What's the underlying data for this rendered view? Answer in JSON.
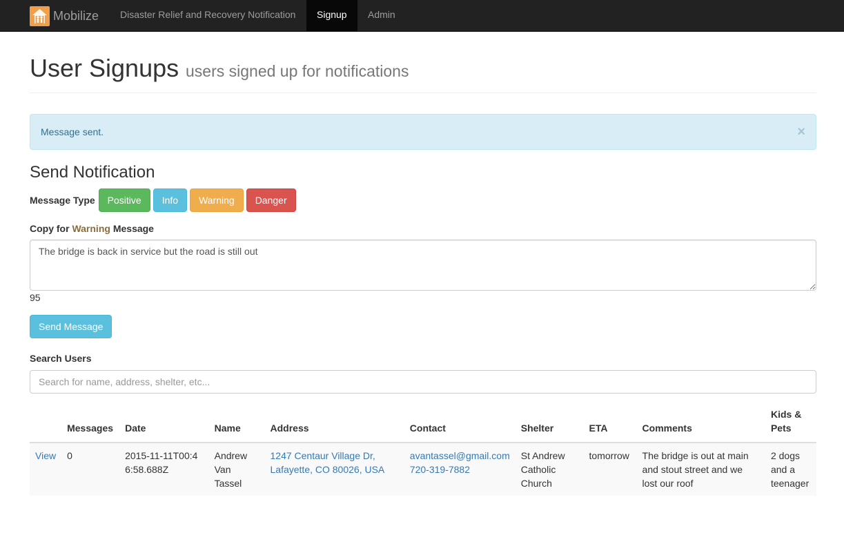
{
  "navbar": {
    "brand": "Mobilize",
    "items": [
      {
        "label": "Disaster Relief and Recovery Notification"
      },
      {
        "label": "Signup"
      },
      {
        "label": "Admin"
      }
    ]
  },
  "header": {
    "title": "User Signups",
    "subtitle": "users signed up for notifications"
  },
  "alert": {
    "message": "Message sent.",
    "close": "×"
  },
  "notification": {
    "title": "Send Notification",
    "message_type_label": "Message Type",
    "types": [
      "Positive",
      "Info",
      "Warning",
      "Danger"
    ],
    "copy_label_prefix": "Copy for",
    "copy_label_type": "Warning",
    "copy_label_suffix": "Message",
    "message_text": "The bridge is back in service but the road is still out",
    "char_count": "95",
    "send_label": "Send Message"
  },
  "search": {
    "label": "Search Users",
    "placeholder": "Search for name, address, shelter, etc..."
  },
  "table": {
    "headers": [
      "",
      "Messages",
      "Date",
      "Name",
      "Address",
      "Contact",
      "Shelter",
      "ETA",
      "Comments",
      "Kids & Pets"
    ],
    "rows": [
      {
        "view": "View",
        "messages": "0",
        "date": "2015-11-11T00:46:58.688Z",
        "name": "Andrew Van Tassel",
        "address": "1247 Centaur Village Dr, Lafayette, CO 80026, USA",
        "email": "avantassel@gmail.com",
        "phone": "720-319-7882",
        "shelter": "St Andrew Catholic Church",
        "eta": "tomorrow",
        "comments": "The bridge is out at main and stout street and we lost our roof",
        "kids_pets": "2 dogs and a teenager"
      }
    ]
  },
  "colors": {
    "navbar_bg": "#222222",
    "positive": "#5cb85c",
    "info": "#5bc0de",
    "warning": "#f0ad4e",
    "danger": "#d9534f",
    "alert_bg": "#d9edf7",
    "link": "#337ab7",
    "brand_logo": "#f0a04b"
  },
  "icons": {
    "brand_logo": "house-people-icon",
    "alert_close": "close-icon"
  }
}
